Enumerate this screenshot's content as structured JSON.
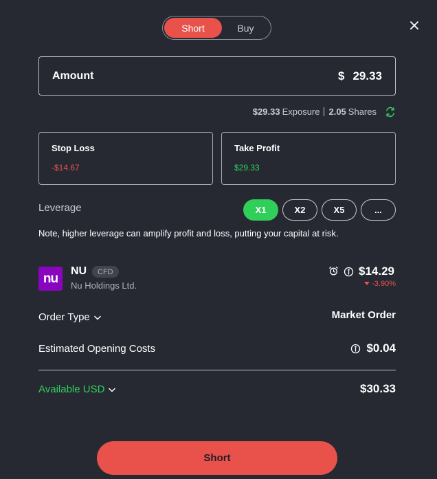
{
  "toggle": {
    "short": "Short",
    "buy": "Buy"
  },
  "amount": {
    "label": "Amount",
    "currency": "$",
    "value": "29.33"
  },
  "exposure": {
    "exposure_value": "$29.33",
    "exposure_label": "Exposure",
    "shares_value": "2.05",
    "shares_label": "Shares"
  },
  "stop_loss": {
    "label": "Stop Loss",
    "value": "-$14.67"
  },
  "take_profit": {
    "label": "Take Profit",
    "value": "$29.33"
  },
  "leverage": {
    "label": "Leverage",
    "options": [
      "X1",
      "X2",
      "X5",
      "..."
    ],
    "selected": "X1"
  },
  "note": "Note, higher leverage can amplify profit and loss, putting your capital at risk.",
  "instrument": {
    "logo_text": "nu",
    "symbol": "NU",
    "badge": "CFD",
    "name": "Nu Holdings Ltd.",
    "price": "$14.29",
    "change": "-3.90%"
  },
  "order_type": {
    "label": "Order Type",
    "value": "Market Order"
  },
  "opening_costs": {
    "label": "Estimated Opening Costs",
    "value": "$0.04"
  },
  "available": {
    "label": "Available USD",
    "value": "$30.33"
  },
  "submit": {
    "label": "Short"
  },
  "colors": {
    "accent_red": "#e8524a",
    "accent_green": "#2fcf5a",
    "background": "#262932",
    "brand_purple": "#8a05be"
  },
  "icons": [
    "close-icon",
    "swap-icon",
    "alarm-icon",
    "info-icon",
    "chevron-down-icon",
    "caret-down-icon"
  ]
}
